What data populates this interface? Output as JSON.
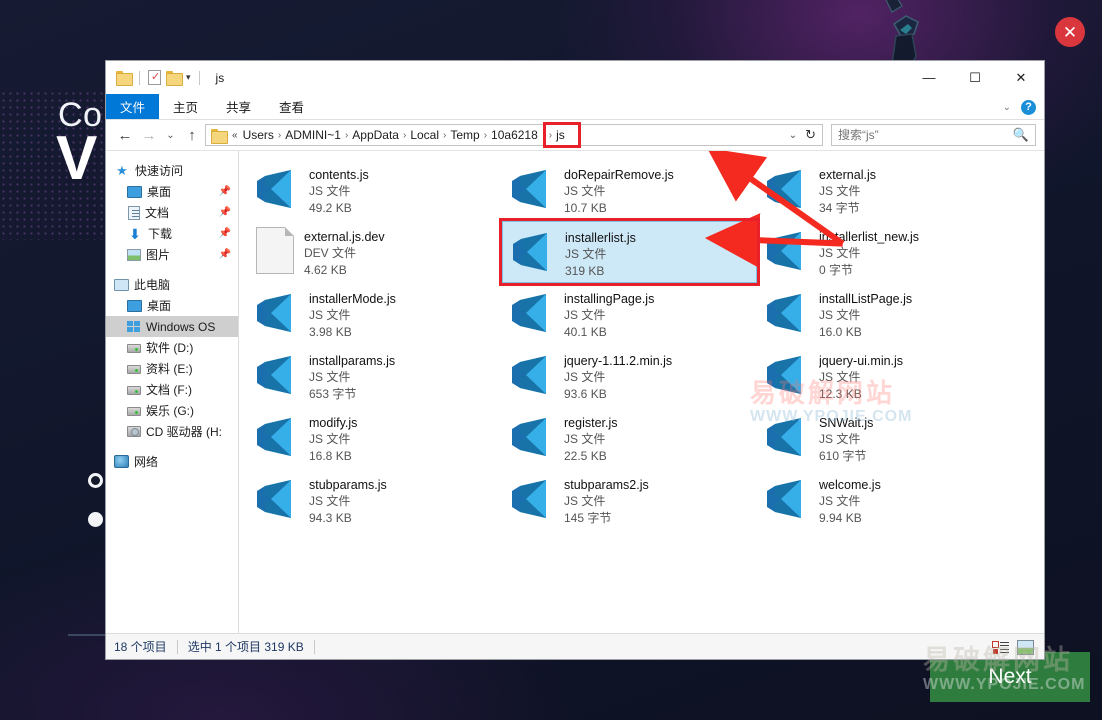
{
  "installer": {
    "title_line1": "Co",
    "title_line2": "V",
    "next_label": "Next",
    "close_icon": "close-circle-icon",
    "accent_green": "#2f7d3e",
    "accent_red": "#d9363e",
    "background_color": "#101528"
  },
  "watermark": {
    "line1": "易破解网站",
    "line2": "WWW.YPOJIE.COM"
  },
  "window": {
    "title": "js",
    "quick_access": [
      "folder-icon",
      "properties-icon",
      "new-folder-icon",
      "customize-caret-icon"
    ],
    "controls": {
      "minimize": "—",
      "maximize": "☐",
      "close": "✕"
    },
    "ribbon_collapse": "⌄",
    "help": "?"
  },
  "ribbon": {
    "tabs": [
      {
        "label": "文件",
        "active": true
      },
      {
        "label": "主页",
        "active": false
      },
      {
        "label": "共享",
        "active": false
      },
      {
        "label": "查看",
        "active": false
      }
    ]
  },
  "nav": {
    "back": "←",
    "forward": "→",
    "history": "⌄",
    "up": "↑",
    "refresh": "↻",
    "address_caret": "⌄"
  },
  "breadcrumb": {
    "root_icon": "folder-icon",
    "overflow": "«",
    "items": [
      "Users",
      "ADMINI~1",
      "AppData",
      "Local",
      "Temp",
      "10a6218"
    ],
    "current": "js",
    "separator": "›"
  },
  "search": {
    "value": "搜索“js”",
    "placeholder": "搜索“js”",
    "icon": "search-icon"
  },
  "sidebar": {
    "groups": [
      {
        "header": {
          "label": "快速访问",
          "icon": "star-pin-icon"
        },
        "items": [
          {
            "label": "桌面",
            "icon": "monitor-icon",
            "pinned": true
          },
          {
            "label": "文档",
            "icon": "document-icon",
            "pinned": true
          },
          {
            "label": "下载",
            "icon": "download-icon",
            "pinned": true
          },
          {
            "label": "图片",
            "icon": "pictures-icon",
            "pinned": true
          }
        ]
      },
      {
        "header": {
          "label": "此电脑",
          "icon": "this-pc-icon"
        },
        "items": [
          {
            "label": "桌面",
            "icon": "monitor-icon",
            "pinned": false
          },
          {
            "label": "Windows OS",
            "icon": "windows-drive-icon",
            "pinned": false,
            "selected": true
          },
          {
            "label": "软件 (D:)",
            "icon": "drive-icon",
            "pinned": false
          },
          {
            "label": "资料 (E:)",
            "icon": "drive-icon",
            "pinned": false
          },
          {
            "label": "文档 (F:)",
            "icon": "drive-icon",
            "pinned": false
          },
          {
            "label": "娱乐 (G:)",
            "icon": "drive-icon",
            "pinned": false
          },
          {
            "label": "CD 驱动器 (H:",
            "icon": "cd-drive-icon",
            "pinned": false
          }
        ]
      },
      {
        "header": {
          "label": "网络",
          "icon": "network-icon"
        },
        "items": []
      }
    ],
    "pin_glyph": "📌"
  },
  "files": [
    {
      "name": "contents.js",
      "type": "JS 文件",
      "size": "49.2 KB",
      "icon": "vscode-js-icon",
      "selected": false
    },
    {
      "name": "doRepairRemove.js",
      "type": "JS 文件",
      "size": "10.7 KB",
      "icon": "vscode-js-icon",
      "selected": false
    },
    {
      "name": "external.js",
      "type": "JS 文件",
      "size": "34 字节",
      "icon": "vscode-js-icon",
      "selected": false
    },
    {
      "name": "external.js.dev",
      "type": "DEV 文件",
      "size": "4.62 KB",
      "icon": "generic-file-icon",
      "selected": false
    },
    {
      "name": "installerlist.js",
      "type": "JS 文件",
      "size": "319 KB",
      "icon": "vscode-js-icon",
      "selected": true
    },
    {
      "name": "installerlist_new.js",
      "type": "JS 文件",
      "size": "0 字节",
      "icon": "vscode-js-icon",
      "selected": false
    },
    {
      "name": "installerMode.js",
      "type": "JS 文件",
      "size": "3.98 KB",
      "icon": "vscode-js-icon",
      "selected": false
    },
    {
      "name": "installingPage.js",
      "type": "JS 文件",
      "size": "40.1 KB",
      "icon": "vscode-js-icon",
      "selected": false
    },
    {
      "name": "installListPage.js",
      "type": "JS 文件",
      "size": "16.0 KB",
      "icon": "vscode-js-icon",
      "selected": false
    },
    {
      "name": "installparams.js",
      "type": "JS 文件",
      "size": "653 字节",
      "icon": "vscode-js-icon",
      "selected": false
    },
    {
      "name": "jquery-1.11.2.min.js",
      "type": "JS 文件",
      "size": "93.6 KB",
      "icon": "vscode-js-icon",
      "selected": false
    },
    {
      "name": "jquery-ui.min.js",
      "type": "JS 文件",
      "size": "12.3 KB",
      "icon": "vscode-js-icon",
      "selected": false
    },
    {
      "name": "modify.js",
      "type": "JS 文件",
      "size": "16.8 KB",
      "icon": "vscode-js-icon",
      "selected": false
    },
    {
      "name": "register.js",
      "type": "JS 文件",
      "size": "22.5 KB",
      "icon": "vscode-js-icon",
      "selected": false
    },
    {
      "name": "SNWait.js",
      "type": "JS 文件",
      "size": "610 字节",
      "icon": "vscode-js-icon",
      "selected": false
    },
    {
      "name": "stubparams.js",
      "type": "JS 文件",
      "size": "94.3 KB",
      "icon": "vscode-js-icon",
      "selected": false
    },
    {
      "name": "stubparams2.js",
      "type": "JS 文件",
      "size": "145 字节",
      "icon": "vscode-js-icon",
      "selected": false
    },
    {
      "name": "welcome.js",
      "type": "JS 文件",
      "size": "9.94 KB",
      "icon": "vscode-js-icon",
      "selected": false
    }
  ],
  "status": {
    "item_count": "18 个项目",
    "selection": "选中 1 个项目  319 KB",
    "view_list_icon": "list-view-icon",
    "view_thumb_icon": "thumbnail-view-icon"
  }
}
